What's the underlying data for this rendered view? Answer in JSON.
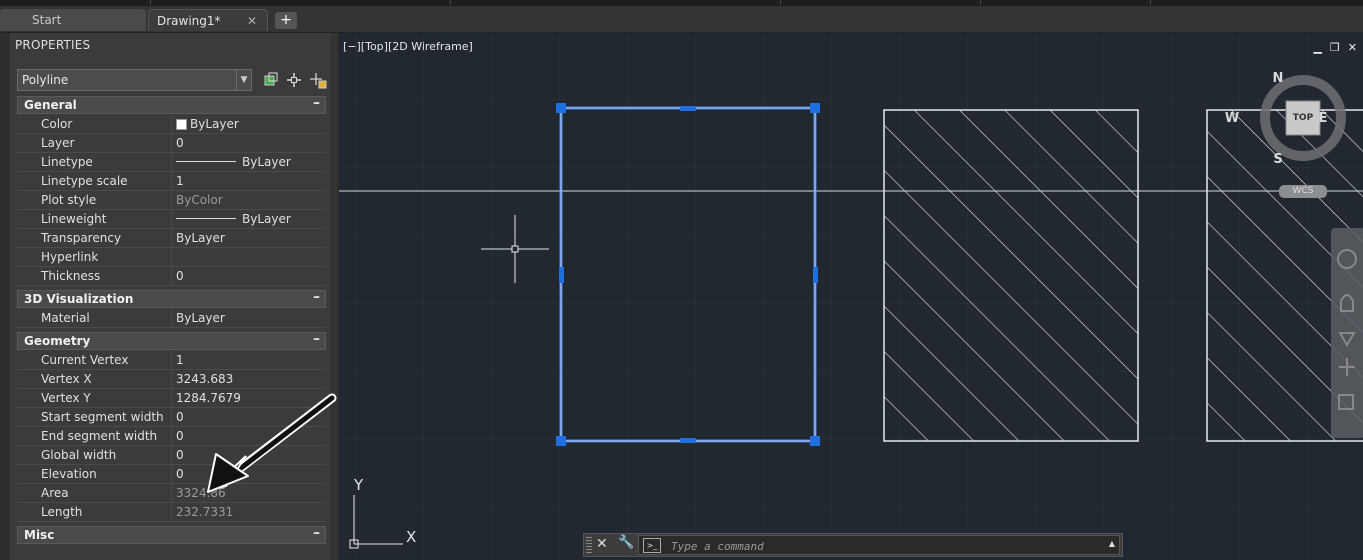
{
  "tabs": [
    {
      "label": "Start"
    },
    {
      "label": "Drawing1*"
    }
  ],
  "new_tab_label": "+",
  "properties": {
    "title": "PROPERTIES",
    "object_type": "Polyline",
    "sections": [
      {
        "title": "General",
        "rows": [
          {
            "label": "Color",
            "value": "ByLayer"
          },
          {
            "label": "Layer",
            "value": "0"
          },
          {
            "label": "Linetype",
            "value": "ByLayer"
          },
          {
            "label": "Linetype scale",
            "value": "1"
          },
          {
            "label": "Plot style",
            "value": "ByColor"
          },
          {
            "label": "Lineweight",
            "value": "ByLayer"
          },
          {
            "label": "Transparency",
            "value": "ByLayer"
          },
          {
            "label": "Hyperlink",
            "value": ""
          },
          {
            "label": "Thickness",
            "value": "0"
          }
        ]
      },
      {
        "title": "3D Visualization",
        "rows": [
          {
            "label": "Material",
            "value": "ByLayer"
          }
        ]
      },
      {
        "title": "Geometry",
        "rows": [
          {
            "label": "Current Vertex",
            "value": "1"
          },
          {
            "label": "Vertex X",
            "value": "3243.683"
          },
          {
            "label": "Vertex Y",
            "value": "1284.7679"
          },
          {
            "label": "Start segment width",
            "value": "0"
          },
          {
            "label": "End segment width",
            "value": "0"
          },
          {
            "label": "Global width",
            "value": "0"
          },
          {
            "label": "Elevation",
            "value": "0"
          },
          {
            "label": "Area",
            "value": "3324.86"
          },
          {
            "label": "Length",
            "value": "232.7331"
          }
        ]
      },
      {
        "title": "Misc",
        "rows": []
      }
    ]
  },
  "viewport": {
    "label": "[−][Top][2D Wireframe]",
    "controls": {
      "minimize": "▁",
      "restore": "❐",
      "close": "✕"
    },
    "viewcube": {
      "n": "N",
      "s": "S",
      "e": "E",
      "w": "W",
      "face": "TOP",
      "ucs": "WCS"
    },
    "ucs_icon": {
      "x": "X",
      "y": "Y"
    }
  },
  "command": {
    "placeholder": "Type a command"
  },
  "colors": {
    "selection": "#4a8cff",
    "grip": "#1e6fe0",
    "hatch": "#e8e8e8",
    "arrow": "#111111"
  }
}
